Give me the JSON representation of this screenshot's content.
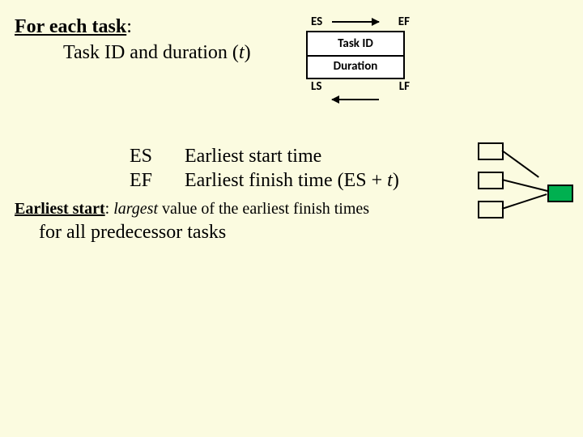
{
  "header": {
    "lead": "For each task",
    "lead_colon": ":",
    "sub_a": "Task ID and duration (",
    "sub_t": "t",
    "sub_b": ")"
  },
  "node": {
    "es": "ES",
    "ef": "EF",
    "task_id": "Task ID",
    "duration": "Duration",
    "ls": "LS",
    "lf": "LF"
  },
  "defs": {
    "es_abbr": "ES",
    "es_text": "Earliest start time",
    "ef_abbr": "EF",
    "ef_text_a": "Earliest finish time (ES + ",
    "ef_text_t": "t",
    "ef_text_b": ")"
  },
  "note": {
    "lead": "Earliest start",
    "colon": ": ",
    "largest": "largest",
    "tail1": " value of the earliest finish times",
    "tail2": "for all predecessor tasks"
  }
}
